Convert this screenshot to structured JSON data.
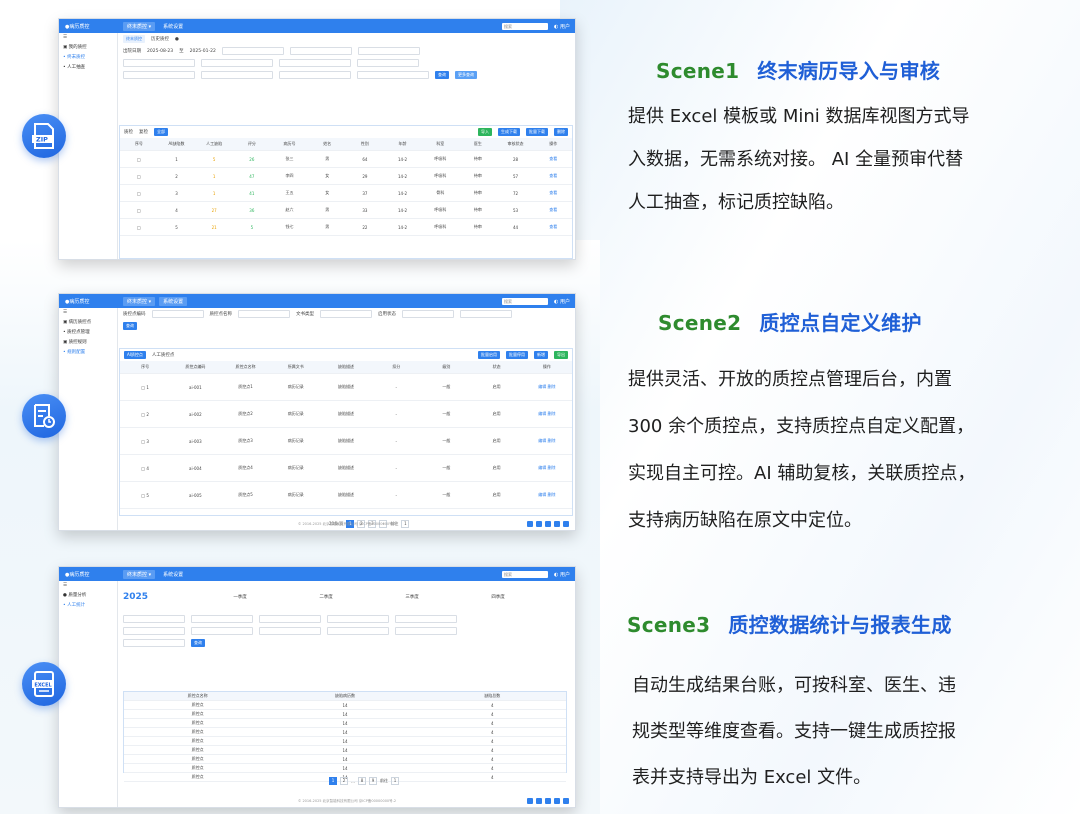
{
  "scenes": [
    {
      "tag": "Scene1",
      "title": "终末病历导入与审核",
      "lines": [
        "提供 Excel 模板或 Mini 数据库视图方式导",
        "入数据，无需系统对接。 AI 全量预审代替",
        "人工抽查，标记质控缺陷。"
      ],
      "icon": "zip-file-icon",
      "icon_label": "ZIP"
    },
    {
      "tag": "Scene2",
      "title": "质控点自定义维护",
      "lines": [
        "提供灵活、开放的质控点管理后台，内置",
        "300 余个质控点，支持质控点自定义配置，",
        "实现自主可控。AI 辅助复核，关联质控点，",
        "支持病历缺陷在原文中定位。"
      ],
      "icon": "document-clock-icon"
    },
    {
      "tag": "Scene3",
      "title": "质控数据统计与报表生成",
      "lines": [
        "自动生成结果台账，可按科室、医生、违",
        "规类型等维度查看。支持一键生成质控报",
        "表并支持导出为 Excel 文件。"
      ],
      "icon": "excel-file-icon",
      "icon_label": "EXCEL"
    }
  ],
  "shot1": {
    "year_label": "2025-08-23",
    "year_label2": "2025-01-22",
    "buttons": [
      "查询",
      "导入",
      "生成下载",
      "批量下载",
      "删除"
    ],
    "headers": [
      "序号",
      "AI缺陷数",
      "人工缺陷",
      "评分",
      "病历号",
      "姓名",
      "性别",
      "年龄",
      "科室",
      "医生",
      "审核状态",
      "操作"
    ],
    "rows": [
      [
        "1",
        "5",
        "26",
        "张三",
        "男",
        "64",
        "14-2",
        "呼吸科",
        "待审",
        "28",
        "查看"
      ],
      [
        "2",
        "1",
        "47",
        "李四",
        "女",
        "29",
        "14-2",
        "呼吸科",
        "待审",
        "57",
        "查看"
      ],
      [
        "3",
        "1",
        "41",
        "王五",
        "女",
        "37",
        "14-2",
        "骨科",
        "待审",
        "72",
        "查看"
      ],
      [
        "4",
        "27",
        "36",
        "赵六",
        "男",
        "33",
        "14-2",
        "呼吸科",
        "待审",
        "53",
        "查看"
      ],
      [
        "5",
        "21",
        "5",
        "钱七",
        "男",
        "22",
        "14-2",
        "呼吸科",
        "待审",
        "44",
        "查看"
      ]
    ]
  },
  "shot3": {
    "year": "2025",
    "quarters": [
      "一季度",
      "二季度",
      "三季度",
      "四季度"
    ],
    "rows": 9
  }
}
